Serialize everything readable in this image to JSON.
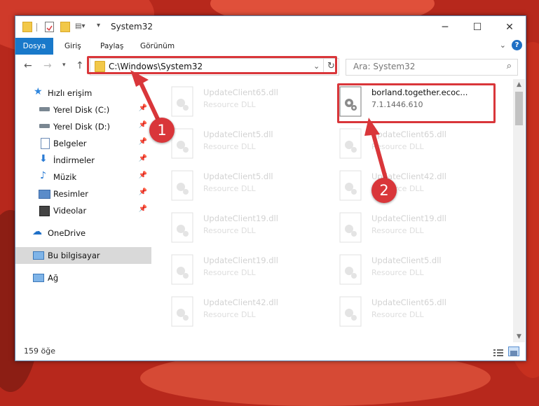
{
  "window": {
    "title": "System32"
  },
  "ribbon": {
    "tabs": [
      "Dosya",
      "Giriş",
      "Paylaş",
      "Görünüm"
    ],
    "help": "?"
  },
  "address": {
    "path": "C:\\Windows\\System32",
    "search_placeholder": "Ara: System32"
  },
  "nav": {
    "items": [
      {
        "label": "Hızlı erişim",
        "icon": "star-icon"
      },
      {
        "label": "Yerel Disk (C:)",
        "icon": "drive-icon"
      },
      {
        "label": "Yerel Disk (D:)",
        "icon": "drive-icon"
      },
      {
        "label": "Belgeler",
        "icon": "document-icon"
      },
      {
        "label": "İndirmeler",
        "icon": "download-icon"
      },
      {
        "label": "Müzik",
        "icon": "music-icon"
      },
      {
        "label": "Resimler",
        "icon": "pictures-icon"
      },
      {
        "label": "Videolar",
        "icon": "video-icon"
      },
      {
        "label": "OneDrive",
        "icon": "cloud-icon"
      },
      {
        "label": "Bu bilgisayar",
        "icon": "computer-icon"
      },
      {
        "label": "Ağ",
        "icon": "network-icon"
      }
    ]
  },
  "files": {
    "highlighted": {
      "name": "borland.together.ecoc...",
      "sub": "7.1.1446.610"
    },
    "left_column": [
      {
        "name": "UpdateClient65.dll",
        "sub": "Resource DLL"
      },
      {
        "name": "UpdateClient5.dll",
        "sub": "Resource DLL"
      },
      {
        "name": "UpdateClient5.dll",
        "sub": "Resource DLL"
      },
      {
        "name": "UpdateClient19.dll",
        "sub": "Resource DLL"
      },
      {
        "name": "UpdateClient19.dll",
        "sub": "Resource DLL"
      },
      {
        "name": "UpdateClient42.dll",
        "sub": "Resource DLL"
      }
    ],
    "right_column": [
      {
        "name": "UpdateClient65.dll",
        "sub": "Resource DLL"
      },
      {
        "name": "UpdateClient42.dll",
        "sub": "Resource DLL"
      },
      {
        "name": "UpdateClient19.dll",
        "sub": "Resource DLL"
      },
      {
        "name": "UpdateClient5.dll",
        "sub": "Resource DLL"
      },
      {
        "name": "UpdateClient65.dll",
        "sub": "Resource DLL"
      }
    ]
  },
  "status": {
    "count": "159 öğe"
  },
  "annotations": {
    "badge1": "1",
    "badge2": "2"
  },
  "colors": {
    "accent": "#1979ca",
    "highlight": "#d9363a"
  }
}
